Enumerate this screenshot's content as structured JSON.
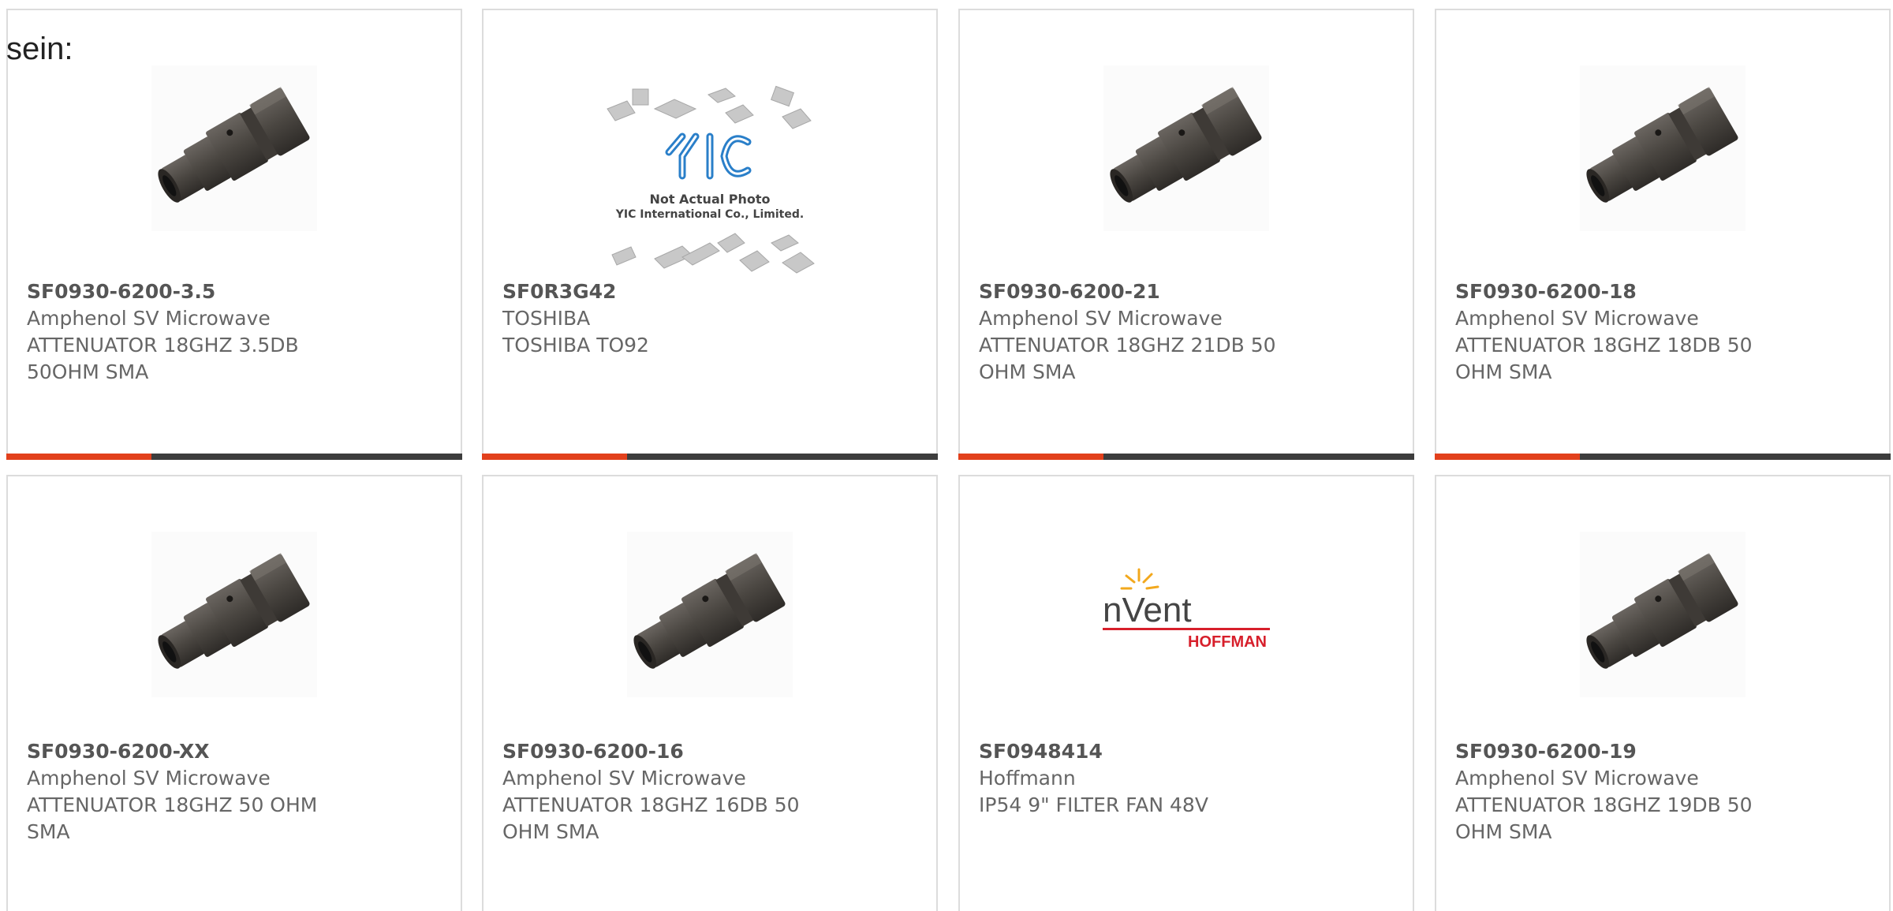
{
  "header_text": "sein:",
  "colors": {
    "accent": "#e2401c",
    "bar": "#3d3d3d",
    "border": "#dcdcdc",
    "text": "#666666"
  },
  "products": [
    {
      "part": "SF0930-6200-3.5",
      "maker": "Amphenol SV Microwave",
      "desc": "ATTENUATOR 18GHZ 3.5DB 50OHM SMA",
      "image": "sma-attenuator-icon"
    },
    {
      "part": "SF0R3G42",
      "maker": "TOSHIBA",
      "desc": "TOSHIBA TO92",
      "image": "yic-not-actual-photo",
      "placeholder": {
        "brand": "YIC",
        "line1": "Not Actual Photo",
        "line2": "YIC International Co., Limited."
      }
    },
    {
      "part": "SF0930-6200-21",
      "maker": "Amphenol SV Microwave",
      "desc": "ATTENUATOR 18GHZ 21DB 50 OHM SMA",
      "image": "sma-attenuator-icon"
    },
    {
      "part": "SF0930-6200-18",
      "maker": "Amphenol SV Microwave",
      "desc": "ATTENUATOR 18GHZ 18DB 50 OHM SMA",
      "image": "sma-attenuator-icon"
    },
    {
      "part": "SF0930-6200-XX",
      "maker": "Amphenol SV Microwave",
      "desc": "ATTENUATOR 18GHZ 50 OHM SMA",
      "image": "sma-attenuator-icon"
    },
    {
      "part": "SF0930-6200-16",
      "maker": "Amphenol SV Microwave",
      "desc": "ATTENUATOR 18GHZ 16DB 50 OHM SMA",
      "image": "sma-attenuator-icon"
    },
    {
      "part": "SF0948414",
      "maker": "Hoffmann",
      "desc": "IP54 9\" FILTER FAN 48V",
      "image": "nvent-hoffman-logo",
      "logo": {
        "name": "nVent",
        "sub": "HOFFMAN"
      }
    },
    {
      "part": "SF0930-6200-19",
      "maker": "Amphenol SV Microwave",
      "desc": "ATTENUATOR 18GHZ 19DB 50 OHM SMA",
      "image": "sma-attenuator-icon"
    }
  ]
}
